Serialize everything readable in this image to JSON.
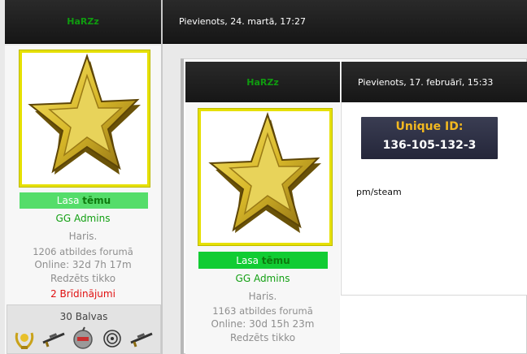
{
  "outer_post": {
    "author": "HaRZz",
    "date": "Pievienots, 24. martā, 17:27",
    "rank_label": "Lasa",
    "rank_emph": "tēmu",
    "group": "GG Admins",
    "real_name": "Haris.",
    "posts": "1206 atbildes forumā",
    "online": "Online: 32d 7h 17m",
    "seen": "Redzēts tikko",
    "warnings": "2 Brīdinājumi",
    "awards_title": "30 Balvas",
    "awards": [
      "laurel-medal-icon",
      "sniper-rifle-icon",
      "bomb-award-icon",
      "target-icon",
      "sniper-rifle-icon"
    ]
  },
  "inner_post": {
    "author": "HaRZz",
    "date": "Pievienots, 17. februārī, 15:33",
    "rank_label": "Lasa",
    "rank_emph": "tēmu",
    "group": "GG Admins",
    "real_name": "Haris.",
    "posts": "1163 atbildes forumā",
    "online": "Online: 30d 15h 23m",
    "seen": "Redzēts tikko",
    "uid_title": "Unique ID:",
    "uid_value": "136-105-132-3",
    "body": "pm/steam"
  },
  "colors": {
    "header_bg": "#1c1c1c",
    "author_name": "#0f9b0f",
    "avatar_border": "#e6e000",
    "rank_outer": "#55dd6a",
    "rank_inner": "#11cc33",
    "warning": "#e01010",
    "uid_bg": "#2e3045",
    "uid_title": "#f2b820"
  }
}
